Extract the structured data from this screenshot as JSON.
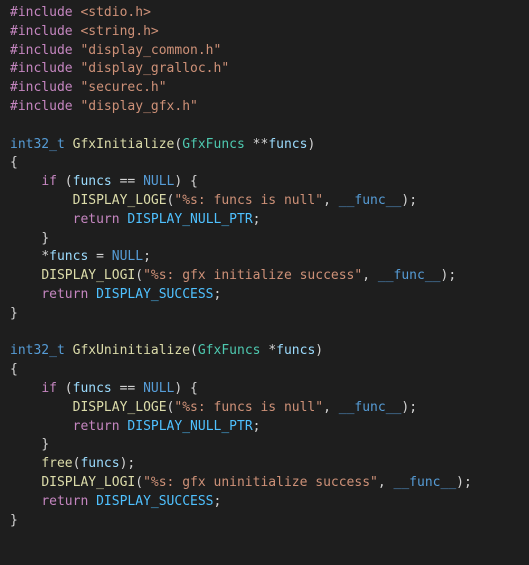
{
  "code": {
    "includes": [
      "<stdio.h>",
      "<string.h>",
      "\"display_common.h\"",
      "\"display_gralloc.h\"",
      "\"securec.h\"",
      "\"display_gfx.h\""
    ],
    "func1": {
      "ret_type": "int32_t",
      "name": "GfxInitialize",
      "param_type": "GfxFuncs",
      "param_name": "funcs",
      "if_cond_var": "funcs",
      "null_macro": "NULL",
      "loge_macro": "DISPLAY_LOGE",
      "loge_fmt": "\"%s: funcs is null\"",
      "func_magic": "__func__",
      "return_kw": "return",
      "null_ptr_const": "DISPLAY_NULL_PTR",
      "assign_lhs": "funcs",
      "assign_rhs": "NULL",
      "logi_macro": "DISPLAY_LOGI",
      "logi_fmt": "\"%s: gfx initialize success\"",
      "success_const": "DISPLAY_SUCCESS"
    },
    "func2": {
      "ret_type": "int32_t",
      "name": "GfxUninitialize",
      "param_type": "GfxFuncs",
      "param_name": "funcs",
      "if_cond_var": "funcs",
      "null_macro": "NULL",
      "loge_macro": "DISPLAY_LOGE",
      "loge_fmt": "\"%s: funcs is null\"",
      "func_magic": "__func__",
      "return_kw": "return",
      "null_ptr_const": "DISPLAY_NULL_PTR",
      "free_fn": "free",
      "free_arg": "funcs",
      "logi_macro": "DISPLAY_LOGI",
      "logi_fmt": "\"%s: gfx uninitialize success\"",
      "success_const": "DISPLAY_SUCCESS"
    },
    "kw_include": "#include",
    "kw_if": "if",
    "kw_return": "return"
  }
}
